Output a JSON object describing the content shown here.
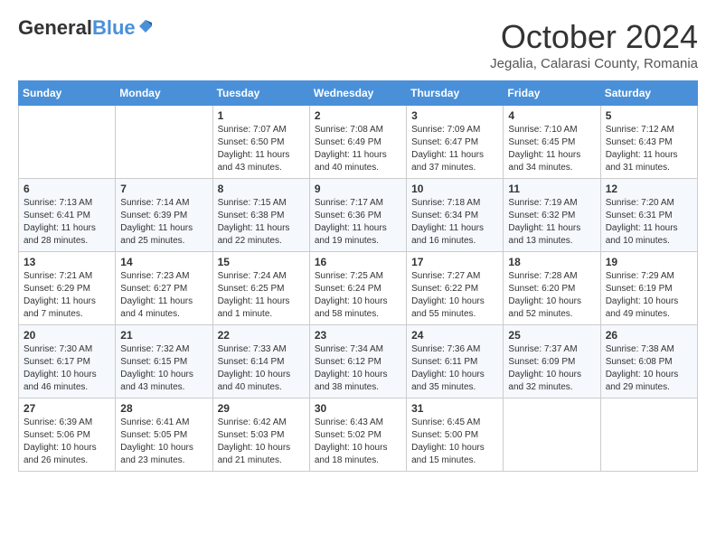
{
  "header": {
    "logo_general": "General",
    "logo_blue": "Blue",
    "month_title": "October 2024",
    "location": "Jegalia, Calarasi County, Romania"
  },
  "weekdays": [
    "Sunday",
    "Monday",
    "Tuesday",
    "Wednesday",
    "Thursday",
    "Friday",
    "Saturday"
  ],
  "weeks": [
    [
      {
        "day": "",
        "info": ""
      },
      {
        "day": "",
        "info": ""
      },
      {
        "day": "1",
        "info": "Sunrise: 7:07 AM\nSunset: 6:50 PM\nDaylight: 11 hours and 43 minutes."
      },
      {
        "day": "2",
        "info": "Sunrise: 7:08 AM\nSunset: 6:49 PM\nDaylight: 11 hours and 40 minutes."
      },
      {
        "day": "3",
        "info": "Sunrise: 7:09 AM\nSunset: 6:47 PM\nDaylight: 11 hours and 37 minutes."
      },
      {
        "day": "4",
        "info": "Sunrise: 7:10 AM\nSunset: 6:45 PM\nDaylight: 11 hours and 34 minutes."
      },
      {
        "day": "5",
        "info": "Sunrise: 7:12 AM\nSunset: 6:43 PM\nDaylight: 11 hours and 31 minutes."
      }
    ],
    [
      {
        "day": "6",
        "info": "Sunrise: 7:13 AM\nSunset: 6:41 PM\nDaylight: 11 hours and 28 minutes."
      },
      {
        "day": "7",
        "info": "Sunrise: 7:14 AM\nSunset: 6:39 PM\nDaylight: 11 hours and 25 minutes."
      },
      {
        "day": "8",
        "info": "Sunrise: 7:15 AM\nSunset: 6:38 PM\nDaylight: 11 hours and 22 minutes."
      },
      {
        "day": "9",
        "info": "Sunrise: 7:17 AM\nSunset: 6:36 PM\nDaylight: 11 hours and 19 minutes."
      },
      {
        "day": "10",
        "info": "Sunrise: 7:18 AM\nSunset: 6:34 PM\nDaylight: 11 hours and 16 minutes."
      },
      {
        "day": "11",
        "info": "Sunrise: 7:19 AM\nSunset: 6:32 PM\nDaylight: 11 hours and 13 minutes."
      },
      {
        "day": "12",
        "info": "Sunrise: 7:20 AM\nSunset: 6:31 PM\nDaylight: 11 hours and 10 minutes."
      }
    ],
    [
      {
        "day": "13",
        "info": "Sunrise: 7:21 AM\nSunset: 6:29 PM\nDaylight: 11 hours and 7 minutes."
      },
      {
        "day": "14",
        "info": "Sunrise: 7:23 AM\nSunset: 6:27 PM\nDaylight: 11 hours and 4 minutes."
      },
      {
        "day": "15",
        "info": "Sunrise: 7:24 AM\nSunset: 6:25 PM\nDaylight: 11 hours and 1 minute."
      },
      {
        "day": "16",
        "info": "Sunrise: 7:25 AM\nSunset: 6:24 PM\nDaylight: 10 hours and 58 minutes."
      },
      {
        "day": "17",
        "info": "Sunrise: 7:27 AM\nSunset: 6:22 PM\nDaylight: 10 hours and 55 minutes."
      },
      {
        "day": "18",
        "info": "Sunrise: 7:28 AM\nSunset: 6:20 PM\nDaylight: 10 hours and 52 minutes."
      },
      {
        "day": "19",
        "info": "Sunrise: 7:29 AM\nSunset: 6:19 PM\nDaylight: 10 hours and 49 minutes."
      }
    ],
    [
      {
        "day": "20",
        "info": "Sunrise: 7:30 AM\nSunset: 6:17 PM\nDaylight: 10 hours and 46 minutes."
      },
      {
        "day": "21",
        "info": "Sunrise: 7:32 AM\nSunset: 6:15 PM\nDaylight: 10 hours and 43 minutes."
      },
      {
        "day": "22",
        "info": "Sunrise: 7:33 AM\nSunset: 6:14 PM\nDaylight: 10 hours and 40 minutes."
      },
      {
        "day": "23",
        "info": "Sunrise: 7:34 AM\nSunset: 6:12 PM\nDaylight: 10 hours and 38 minutes."
      },
      {
        "day": "24",
        "info": "Sunrise: 7:36 AM\nSunset: 6:11 PM\nDaylight: 10 hours and 35 minutes."
      },
      {
        "day": "25",
        "info": "Sunrise: 7:37 AM\nSunset: 6:09 PM\nDaylight: 10 hours and 32 minutes."
      },
      {
        "day": "26",
        "info": "Sunrise: 7:38 AM\nSunset: 6:08 PM\nDaylight: 10 hours and 29 minutes."
      }
    ],
    [
      {
        "day": "27",
        "info": "Sunrise: 6:39 AM\nSunset: 5:06 PM\nDaylight: 10 hours and 26 minutes."
      },
      {
        "day": "28",
        "info": "Sunrise: 6:41 AM\nSunset: 5:05 PM\nDaylight: 10 hours and 23 minutes."
      },
      {
        "day": "29",
        "info": "Sunrise: 6:42 AM\nSunset: 5:03 PM\nDaylight: 10 hours and 21 minutes."
      },
      {
        "day": "30",
        "info": "Sunrise: 6:43 AM\nSunset: 5:02 PM\nDaylight: 10 hours and 18 minutes."
      },
      {
        "day": "31",
        "info": "Sunrise: 6:45 AM\nSunset: 5:00 PM\nDaylight: 10 hours and 15 minutes."
      },
      {
        "day": "",
        "info": ""
      },
      {
        "day": "",
        "info": ""
      }
    ]
  ]
}
